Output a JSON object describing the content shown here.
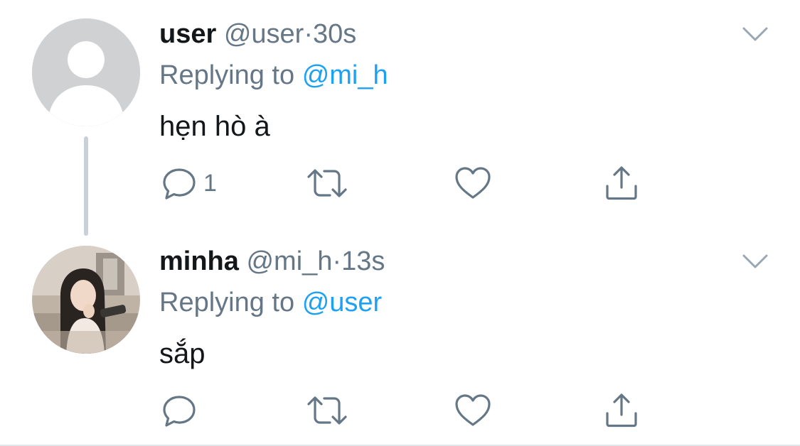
{
  "colors": {
    "text": "#14171a",
    "secondary": "#657786",
    "link": "#1da1f2",
    "thread_line": "#c9d1d8",
    "default_avatar_bg": "#cfd1d3"
  },
  "tweets": [
    {
      "display_name": "user",
      "handle": "@user",
      "separator": "·",
      "timestamp": "30s",
      "replying_prefix": "Replying to",
      "replying_to": "@mi_h",
      "text": "hẹn hò à",
      "reply_count": "1",
      "avatar_icon": "default-profile-icon"
    },
    {
      "display_name": "minha",
      "handle": "@mi_h",
      "separator": "·",
      "timestamp": "13s",
      "replying_prefix": "Replying to",
      "replying_to": "@user",
      "text": "sắp",
      "reply_count": "",
      "avatar_icon": "profile-photo"
    }
  ],
  "icons": {
    "menu": "chevron-down-icon",
    "reply": "reply-icon",
    "retweet": "retweet-icon",
    "like": "heart-icon",
    "share": "share-icon"
  }
}
